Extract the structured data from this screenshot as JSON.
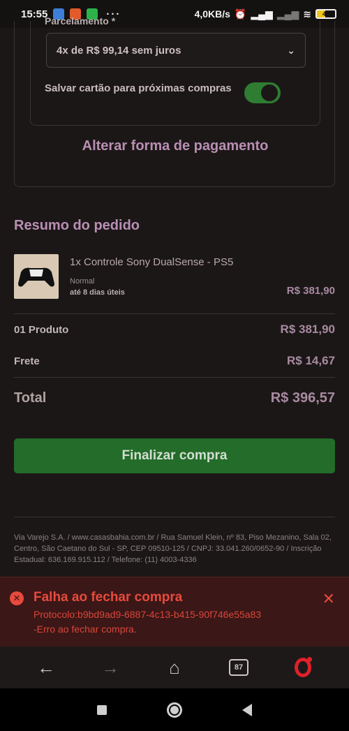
{
  "status_bar": {
    "time": "15:55",
    "dots": "···",
    "speed": "4,0KB/s",
    "battery": "45"
  },
  "payment": {
    "installment_label": "Parcelamento *",
    "installment_value": "4x de R$ 99,14 sem juros",
    "save_card_label": "Salvar cartão para próximas compras",
    "save_card_enabled": true,
    "change_payment": "Alterar forma de pagamento"
  },
  "summary": {
    "title": "Resumo do pedido",
    "product_name": "1x Controle Sony DualSense - PS5",
    "ship_type": "Normal",
    "ship_time": "até 8 dias úteis",
    "product_price": "R$ 381,90",
    "products_label": "01 Produto",
    "products_value": "R$ 381,90",
    "shipping_label": "Frete",
    "shipping_value": "R$ 14,67",
    "total_label": "Total",
    "total_value": "R$ 396,57",
    "finalize_button": "Finalizar compra"
  },
  "footer": {
    "text": "Via Varejo S.A. / www.casasbahia.com.br / Rua Samuel Klein, nº 83, Piso Mezanino, Sala 02, Centro, São Caetano do Sul - SP, CEP 09510-125 / CNPJ: 33.041.260/0652-90 / Inscrição Estadual: 636.169.915.112 / Telefone: (11) 4003-4336"
  },
  "error": {
    "title": "Falha ao fechar compra",
    "protocol": "Protocolo:b9bd9ad9-6887-4c13-b415-90f746e55a83",
    "message": "-Erro ao fechar compra."
  },
  "browser_bar": {
    "tabs_count": "87"
  },
  "colors": {
    "accent_purple": "#b98fb3",
    "finalize_green": "#236c2a",
    "error_red": "#e84a3c"
  }
}
